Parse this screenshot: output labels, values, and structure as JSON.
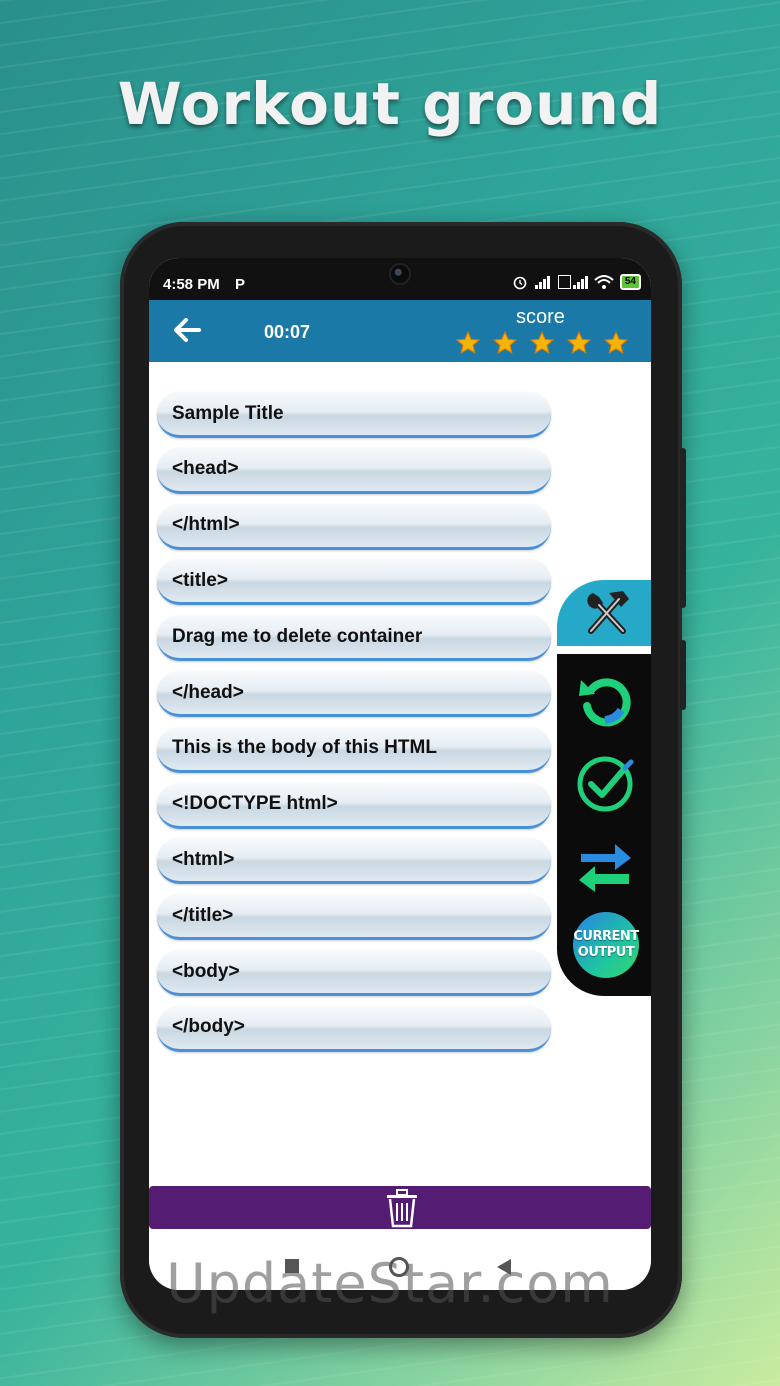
{
  "headline": "Workout ground",
  "status_bar": {
    "time": "4:58 PM",
    "p_icon": "P",
    "battery": "54"
  },
  "app_bar": {
    "back_icon": "arrow-left-icon",
    "timer": "00:07",
    "score_label": "score",
    "stars": 5
  },
  "code_blocks": [
    "Sample Title",
    "<head>",
    "</html>",
    "<title>",
    "Drag me to delete container",
    "</head>",
    "This is the body of this HTML",
    "<!DOCTYPE html>",
    "<html>",
    "</title>",
    "<body>",
    "</body>"
  ],
  "tools": {
    "tools_icon": "hammer-wrench-icon",
    "reset_icon": "reset-icon",
    "check_icon": "check-icon",
    "swap_icon": "swap-arrows-icon",
    "output_line1": "CURRENT",
    "output_line2": "OUTPUT"
  },
  "trash_icon": "trash-icon",
  "watermark": "UpdateStar.com",
  "colors": {
    "app_bar": "#1b79a8",
    "trash_bar": "#551c73",
    "tools_tab": "#26a8c9",
    "pill_underline": "#4a90d9"
  }
}
